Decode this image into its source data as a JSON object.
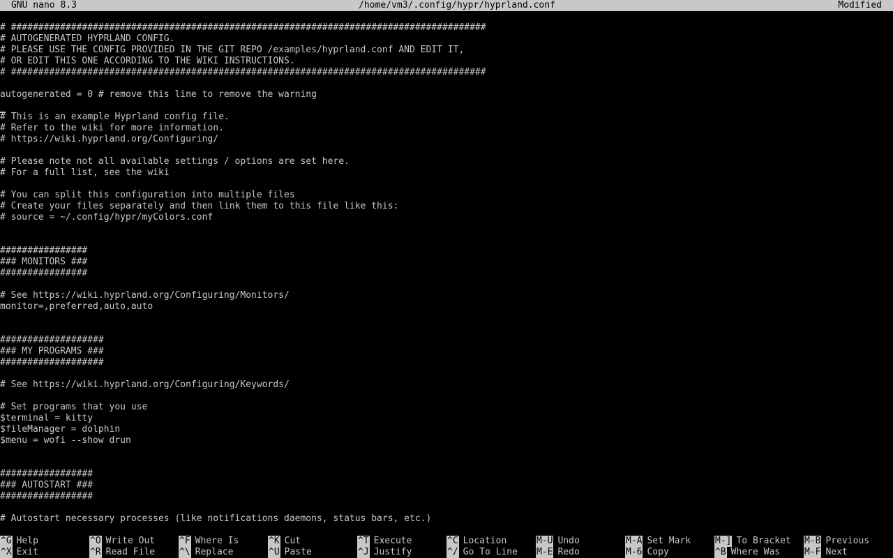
{
  "titlebar": {
    "app": "GNU nano 8.3",
    "path": "/home/vm3/.config/hypr/hyprland.conf",
    "status": "Modified"
  },
  "editor": {
    "lines": [
      "# #######################################################################################",
      "# AUTOGENERATED HYPRLAND CONFIG.",
      "# PLEASE USE THE CONFIG PROVIDED IN THE GIT REPO /examples/hyprland.conf AND EDIT IT,",
      "# OR EDIT THIS ONE ACCORDING TO THE WIKI INSTRUCTIONS.",
      "# #######################################################################################",
      "",
      "autogenerated = 0 # remove this line to remove the warning",
      "",
      "# This is an example Hyprland config file.",
      "# Refer to the wiki for more information.",
      "# https://wiki.hyprland.org/Configuring/",
      "",
      "# Please note not all available settings / options are set here.",
      "# For a full list, see the wiki",
      "",
      "# You can split this configuration into multiple files",
      "# Create your files separately and then link them to this file like this:",
      "# source = ~/.config/hypr/myColors.conf",
      "",
      "",
      "################",
      "### MONITORS ###",
      "################",
      "",
      "# See https://wiki.hyprland.org/Configuring/Monitors/",
      "monitor=,preferred,auto,auto",
      "",
      "",
      "###################",
      "### MY PROGRAMS ###",
      "###################",
      "",
      "# See https://wiki.hyprland.org/Configuring/Keywords/",
      "",
      "# Set programs that you use",
      "$terminal = kitty",
      "$fileManager = dolphin",
      "$menu = wofi --show drun",
      "",
      "",
      "#################",
      "### AUTOSTART ###",
      "#################",
      "",
      "# Autostart necessary processes (like notifications daemons, status bars, etc.)"
    ]
  },
  "shortcuts": [
    {
      "key": "^G",
      "label": "Help"
    },
    {
      "key": "^O",
      "label": "Write Out"
    },
    {
      "key": "^F",
      "label": "Where Is"
    },
    {
      "key": "^K",
      "label": "Cut"
    },
    {
      "key": "^T",
      "label": "Execute"
    },
    {
      "key": "^C",
      "label": "Location"
    },
    {
      "key": "M-U",
      "label": "Undo"
    },
    {
      "key": "M-A",
      "label": "Set Mark"
    },
    {
      "key": "M-]",
      "label": "To Bracket"
    },
    {
      "key": "M-B",
      "label": "Previous"
    },
    {
      "key": "^X",
      "label": "Exit"
    },
    {
      "key": "^R",
      "label": "Read File"
    },
    {
      "key": "^\\",
      "label": "Replace"
    },
    {
      "key": "^U",
      "label": "Paste"
    },
    {
      "key": "^J",
      "label": "Justify"
    },
    {
      "key": "^/",
      "label": "Go To Line"
    },
    {
      "key": "M-E",
      "label": "Redo"
    },
    {
      "key": "M-6",
      "label": "Copy"
    },
    {
      "key": "^B",
      "label": "Where Was"
    },
    {
      "key": "M-F",
      "label": "Next"
    }
  ]
}
